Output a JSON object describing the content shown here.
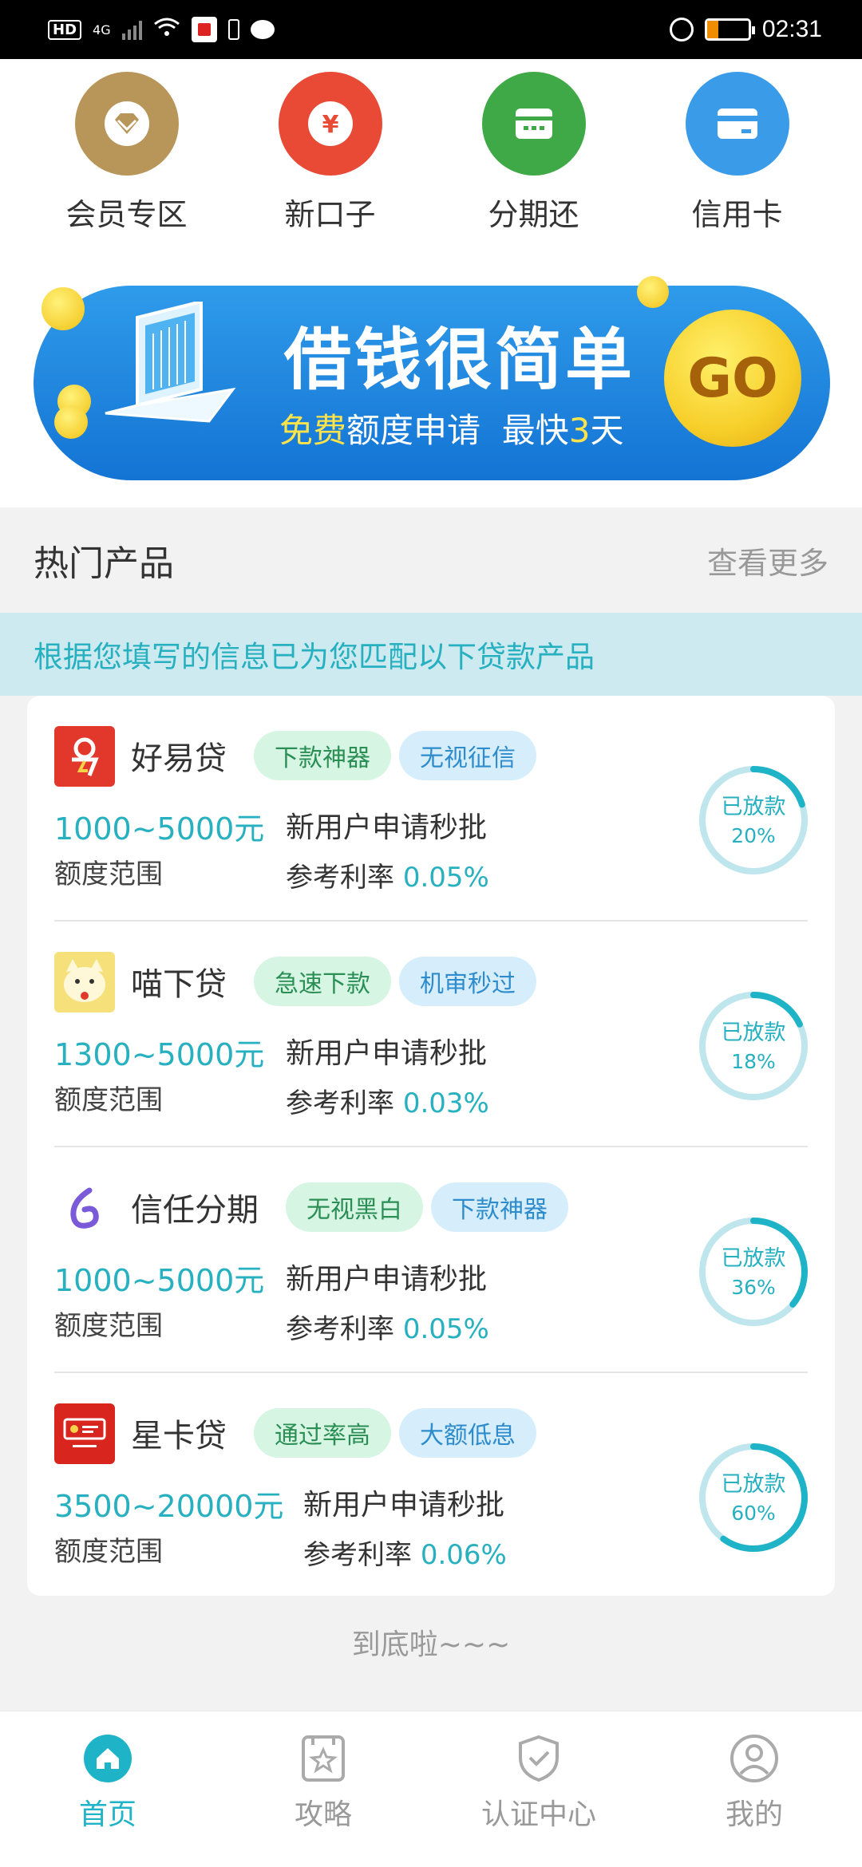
{
  "status_bar": {
    "network": "4G",
    "hd": "HD",
    "time": "02:31"
  },
  "quick_menu": [
    {
      "label": "会员专区",
      "icon": "diamond-icon",
      "color": "#b8965a"
    },
    {
      "label": "新口子",
      "icon": "yuan-icon",
      "color": "#e84a36"
    },
    {
      "label": "分期还",
      "icon": "wallet-icon",
      "color": "#3ea946"
    },
    {
      "label": "信用卡",
      "icon": "credit-card-icon",
      "color": "#3a9be8"
    }
  ],
  "banner": {
    "title": "借钱很简单",
    "sub_free": "免费",
    "sub_mid": "额度申请  最快",
    "sub_days": "3",
    "sub_end": "天",
    "go": "GO"
  },
  "hot": {
    "title": "热门产品",
    "more": "查看更多",
    "notice": "根据您填写的信息已为您匹配以下贷款产品"
  },
  "products": [
    {
      "name": "好易贷",
      "tags": [
        "下款神器",
        "无视征信"
      ],
      "amount": "1000~5000元",
      "range_label": "额度范围",
      "feature": "新用户申请秒批",
      "rate_label": "参考利率",
      "rate": "0.05%",
      "ring_label": "已放款",
      "ring_pct": "20%",
      "progress": 0.2
    },
    {
      "name": "喵下贷",
      "tags": [
        "急速下款",
        "机审秒过"
      ],
      "amount": "1300~5000元",
      "range_label": "额度范围",
      "feature": "新用户申请秒批",
      "rate_label": "参考利率",
      "rate": "0.03%",
      "ring_label": "已放款",
      "ring_pct": "18%",
      "progress": 0.18
    },
    {
      "name": "信任分期",
      "tags": [
        "无视黑白",
        "下款神器"
      ],
      "amount": "1000~5000元",
      "range_label": "额度范围",
      "feature": "新用户申请秒批",
      "rate_label": "参考利率",
      "rate": "0.05%",
      "ring_label": "已放款",
      "ring_pct": "36%",
      "progress": 0.36
    },
    {
      "name": "星卡贷",
      "tags": [
        "通过率高",
        "大额低息"
      ],
      "amount": "3500~20000元",
      "range_label": "额度范围",
      "feature": "新用户申请秒批",
      "rate_label": "参考利率",
      "rate": "0.06%",
      "ring_label": "已放款",
      "ring_pct": "60%",
      "progress": 0.6
    }
  ],
  "end_text": "到底啦~~~",
  "nav": [
    {
      "label": "首页",
      "icon": "home-icon",
      "active": true
    },
    {
      "label": "攻略",
      "icon": "star-book-icon",
      "active": false
    },
    {
      "label": "认证中心",
      "icon": "shield-check-icon",
      "active": false
    },
    {
      "label": "我的",
      "icon": "user-icon",
      "active": false
    }
  ],
  "colors": {
    "accent": "#1fb3c8",
    "teal_text": "#26b0c0"
  }
}
